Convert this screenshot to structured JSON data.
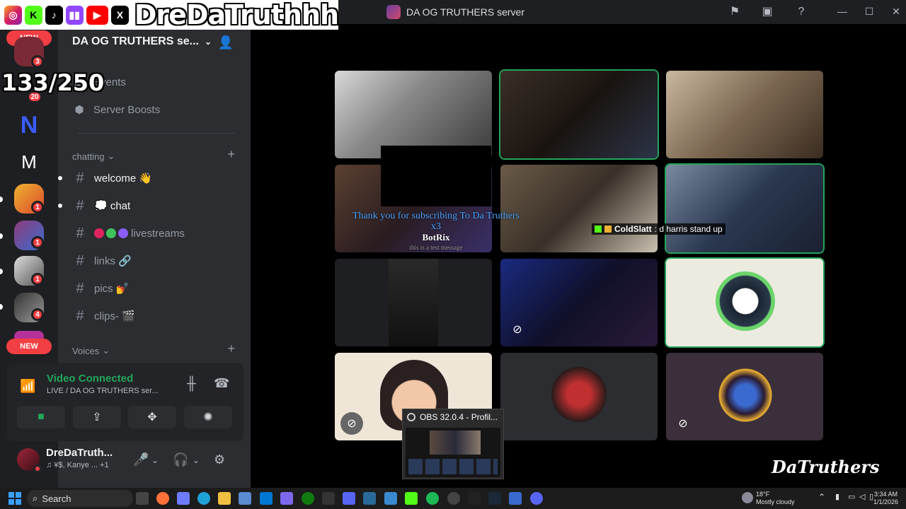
{
  "overlay": {
    "handle": "DreDaTruthhh",
    "sub_counter": "133/250",
    "watermark": "DaTruthers"
  },
  "window": {
    "title": "DA OG TRUTHERS server"
  },
  "rail": {
    "new_label_top": "NEW",
    "new_label_bottom": "NEW",
    "badges": [
      "3",
      "20",
      "1",
      "1",
      "1",
      "4"
    ]
  },
  "sidebar": {
    "server_name": "DA OG TRUTHERS se...",
    "events_label": "Events",
    "boosts_label": "Server Boosts",
    "categories": {
      "chatting": "chatting",
      "voices": "Voices"
    },
    "channels": [
      {
        "name": "welcome 👋",
        "unread": true
      },
      {
        "name": "💭 chat",
        "unread": true
      },
      {
        "name": "livestreams",
        "unread": false
      },
      {
        "name": "links 🔗",
        "unread": false
      },
      {
        "name": "pics 💅",
        "unread": false
      },
      {
        "name": "clips- 🎬",
        "unread": false
      }
    ]
  },
  "voice": {
    "status": "Video Connected",
    "channel": "LIVE / DA OG TRUTHERS ser..."
  },
  "user": {
    "name": "DreDaTruth...",
    "status": "♫ ¥$, Kanye ... +1"
  },
  "stage": {
    "sub_alert": {
      "line1": "Thank you for subscribing To Da Truthers",
      "line2": "x3",
      "name": "BotRix",
      "message": "this is a test message"
    },
    "chat_overlay": {
      "user": "ColdSlatt",
      "text": ": d harris stand up"
    },
    "obs_tooltip": "OBS 32.0.4 - Profil..."
  },
  "taskbar": {
    "search_placeholder": "Search",
    "weather_temp": "18°F",
    "weather_desc": "Mostly cloudy",
    "time": "3:34 AM",
    "date": "1/1/2026"
  },
  "colors": {
    "speaking": "#23a55a",
    "mention": "#f23f43",
    "sidebar_bg": "#2b2d31",
    "rail_bg": "#1e1f22"
  }
}
